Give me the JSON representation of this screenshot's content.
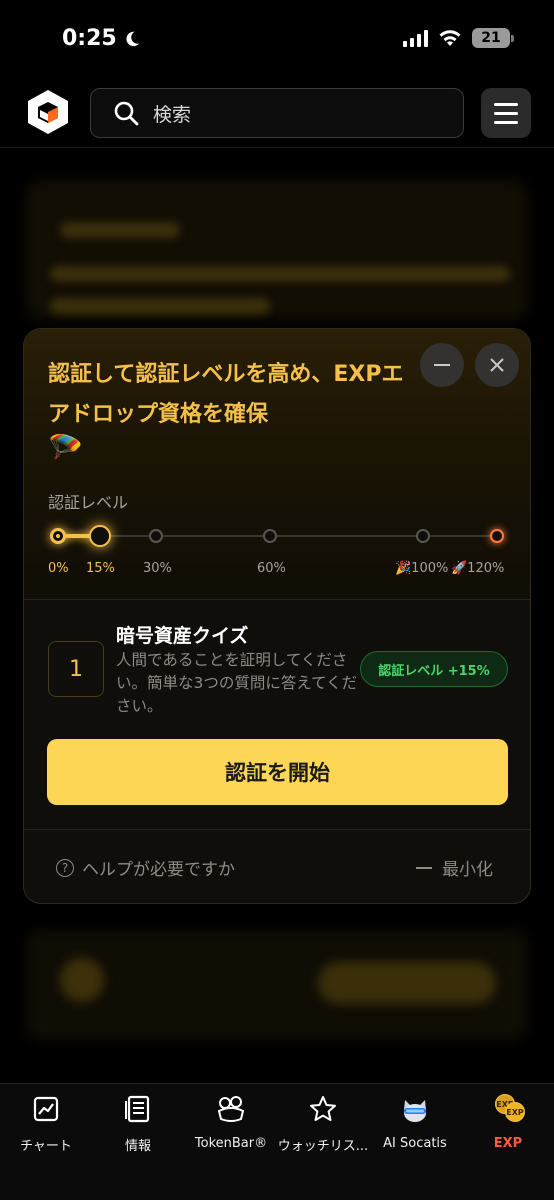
{
  "status_bar": {
    "time": "0:25",
    "battery": "21"
  },
  "header": {
    "search_placeholder": "検索"
  },
  "modal": {
    "title": "認証して認証レベルを高め、EXPエアドロップ資格を確保",
    "title_emoji": "🪂",
    "level_label": "認証レベル",
    "progress_percent": 15,
    "levels": [
      "0%",
      "15%",
      "30%",
      "60%",
      "🎉100%",
      "🚀120%"
    ],
    "task": {
      "number": "1",
      "title": "暗号資産クイズ",
      "description": "人間であることを証明してください。簡単な3つの質問に答えてください。",
      "badge": "認証レベル +15%"
    },
    "start_button": "認証を開始",
    "help": "ヘルプが必要ですか",
    "minimize": "最小化"
  },
  "tabbar": {
    "tabs": [
      {
        "label": "チャート",
        "icon": "chart-icon"
      },
      {
        "label": "情報",
        "icon": "news-icon"
      },
      {
        "label": "TokenBar®",
        "icon": "tokenbar-icon"
      },
      {
        "label": "ウォッチリス...",
        "icon": "star-icon"
      },
      {
        "label": "AI Socatis",
        "icon": "ai-cat-icon"
      },
      {
        "label": "EXP",
        "icon": "exp-coins-icon"
      }
    ]
  },
  "colors": {
    "accent_yellow": "#fdd655",
    "title_gold": "#f5c04a",
    "badge_green": "#4fd36b",
    "active_tab": "#ff5a3d"
  }
}
